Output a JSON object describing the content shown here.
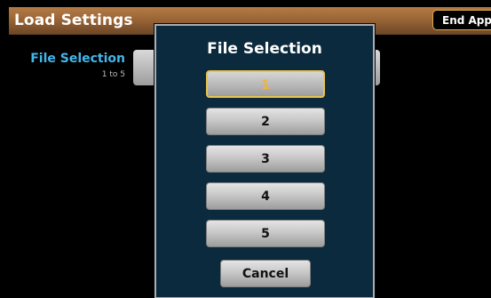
{
  "header": {
    "title": "Load Settings",
    "end_app_label": "End App"
  },
  "field": {
    "label": "File Selection",
    "range": "1 to 5"
  },
  "dialog": {
    "title": "File Selection",
    "options": [
      "1",
      "2",
      "3",
      "4",
      "5"
    ],
    "selected": "1",
    "cancel_label": "Cancel"
  },
  "colors": {
    "titlebar": "#9a6536",
    "accent_blue": "#43b6ea",
    "selected_border": "#e9c34b",
    "dialog_bg": "#0b2a3d"
  }
}
